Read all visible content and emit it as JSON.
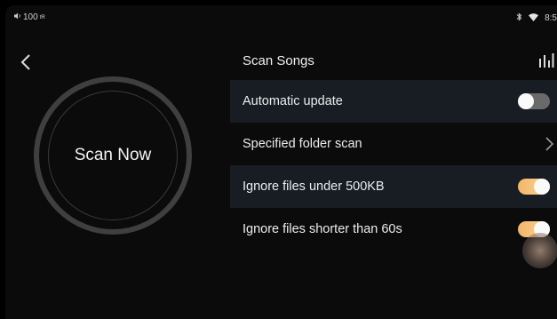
{
  "status_bar": {
    "battery": "100",
    "wifi_label": "",
    "time": "8:5"
  },
  "header": {
    "title": "Scan Songs"
  },
  "scan_button": {
    "label": "Scan Now"
  },
  "settings": [
    {
      "label": "Automatic update",
      "control": "toggle",
      "state": "off"
    },
    {
      "label": "Specified folder scan",
      "control": "chevron"
    },
    {
      "label": "Ignore files under 500KB",
      "control": "toggle",
      "state": "on"
    },
    {
      "label": "Ignore files shorter than 60s",
      "control": "toggle",
      "state": "on"
    }
  ],
  "colors": {
    "accent": "#f3b565",
    "row_alt": "#171d22",
    "ring": "#3f3f3f"
  },
  "icons": [
    "speaker-icon",
    "bluetooth-icon",
    "wifi-icon",
    "back-chevron-icon",
    "equalizer-icon",
    "chevron-right-icon"
  ]
}
